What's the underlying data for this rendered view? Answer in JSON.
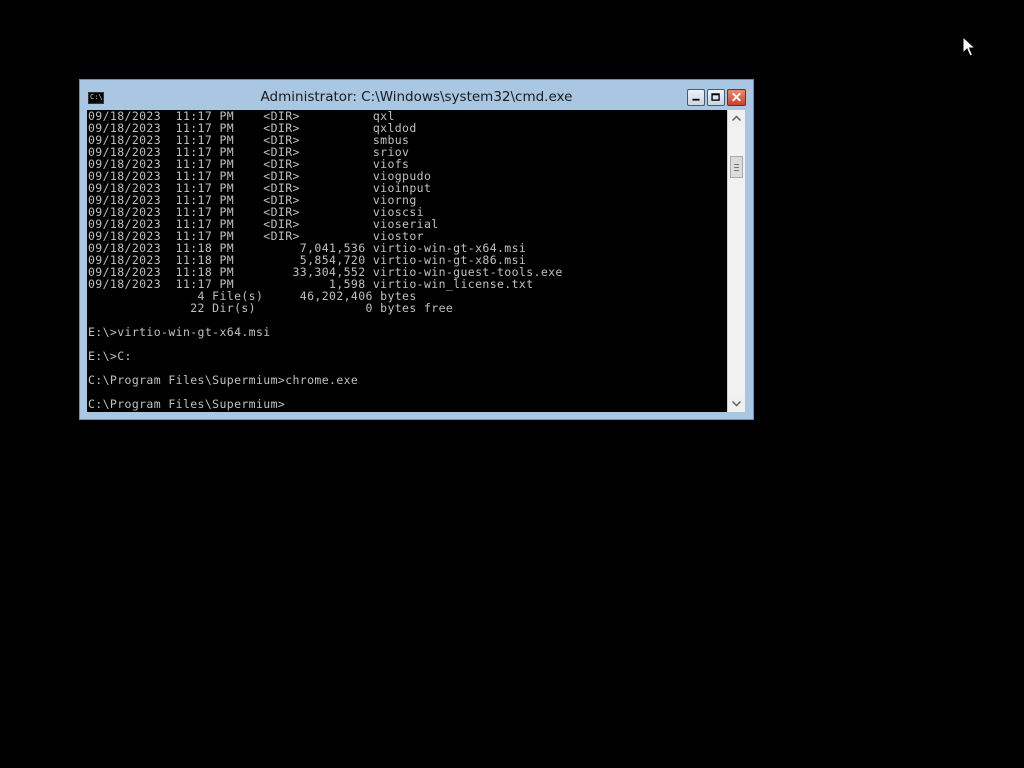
{
  "window": {
    "title": "Administrator: C:\\Windows\\system32\\cmd.exe",
    "icon_name": "cmd-icon",
    "icon_text": "C:\\",
    "controls": {
      "minimize": "minimize-icon",
      "maximize": "maximize-icon",
      "close": "close-icon"
    }
  },
  "console": {
    "lines": [
      "09/18/2023  11:17 PM    <DIR>          qxl",
      "09/18/2023  11:17 PM    <DIR>          qxldod",
      "09/18/2023  11:17 PM    <DIR>          smbus",
      "09/18/2023  11:17 PM    <DIR>          sriov",
      "09/18/2023  11:17 PM    <DIR>          viofs",
      "09/18/2023  11:17 PM    <DIR>          viogpudo",
      "09/18/2023  11:17 PM    <DIR>          vioinput",
      "09/18/2023  11:17 PM    <DIR>          viorng",
      "09/18/2023  11:17 PM    <DIR>          vioscsi",
      "09/18/2023  11:17 PM    <DIR>          vioserial",
      "09/18/2023  11:17 PM    <DIR>          viostor",
      "09/18/2023  11:18 PM         7,041,536 virtio-win-gt-x64.msi",
      "09/18/2023  11:18 PM         5,854,720 virtio-win-gt-x86.msi",
      "09/18/2023  11:18 PM        33,304,552 virtio-win-guest-tools.exe",
      "09/18/2023  11:17 PM             1,598 virtio-win_license.txt",
      "               4 File(s)     46,202,406 bytes",
      "              22 Dir(s)               0 bytes free",
      "",
      "E:\\>virtio-win-gt-x64.msi",
      "",
      "E:\\>C:",
      "",
      "C:\\Program Files\\Supermium>chrome.exe",
      "",
      "C:\\Program Files\\Supermium>"
    ]
  },
  "scrollbar": {
    "up_icon": "scroll-up-arrow-icon",
    "down_icon": "scroll-down-arrow-icon"
  },
  "colors": {
    "desktop": "#000000",
    "console_bg": "#000000",
    "console_text": "#c0c0c0",
    "frame": "#a9c6e3",
    "close_button": "#c8432a"
  }
}
